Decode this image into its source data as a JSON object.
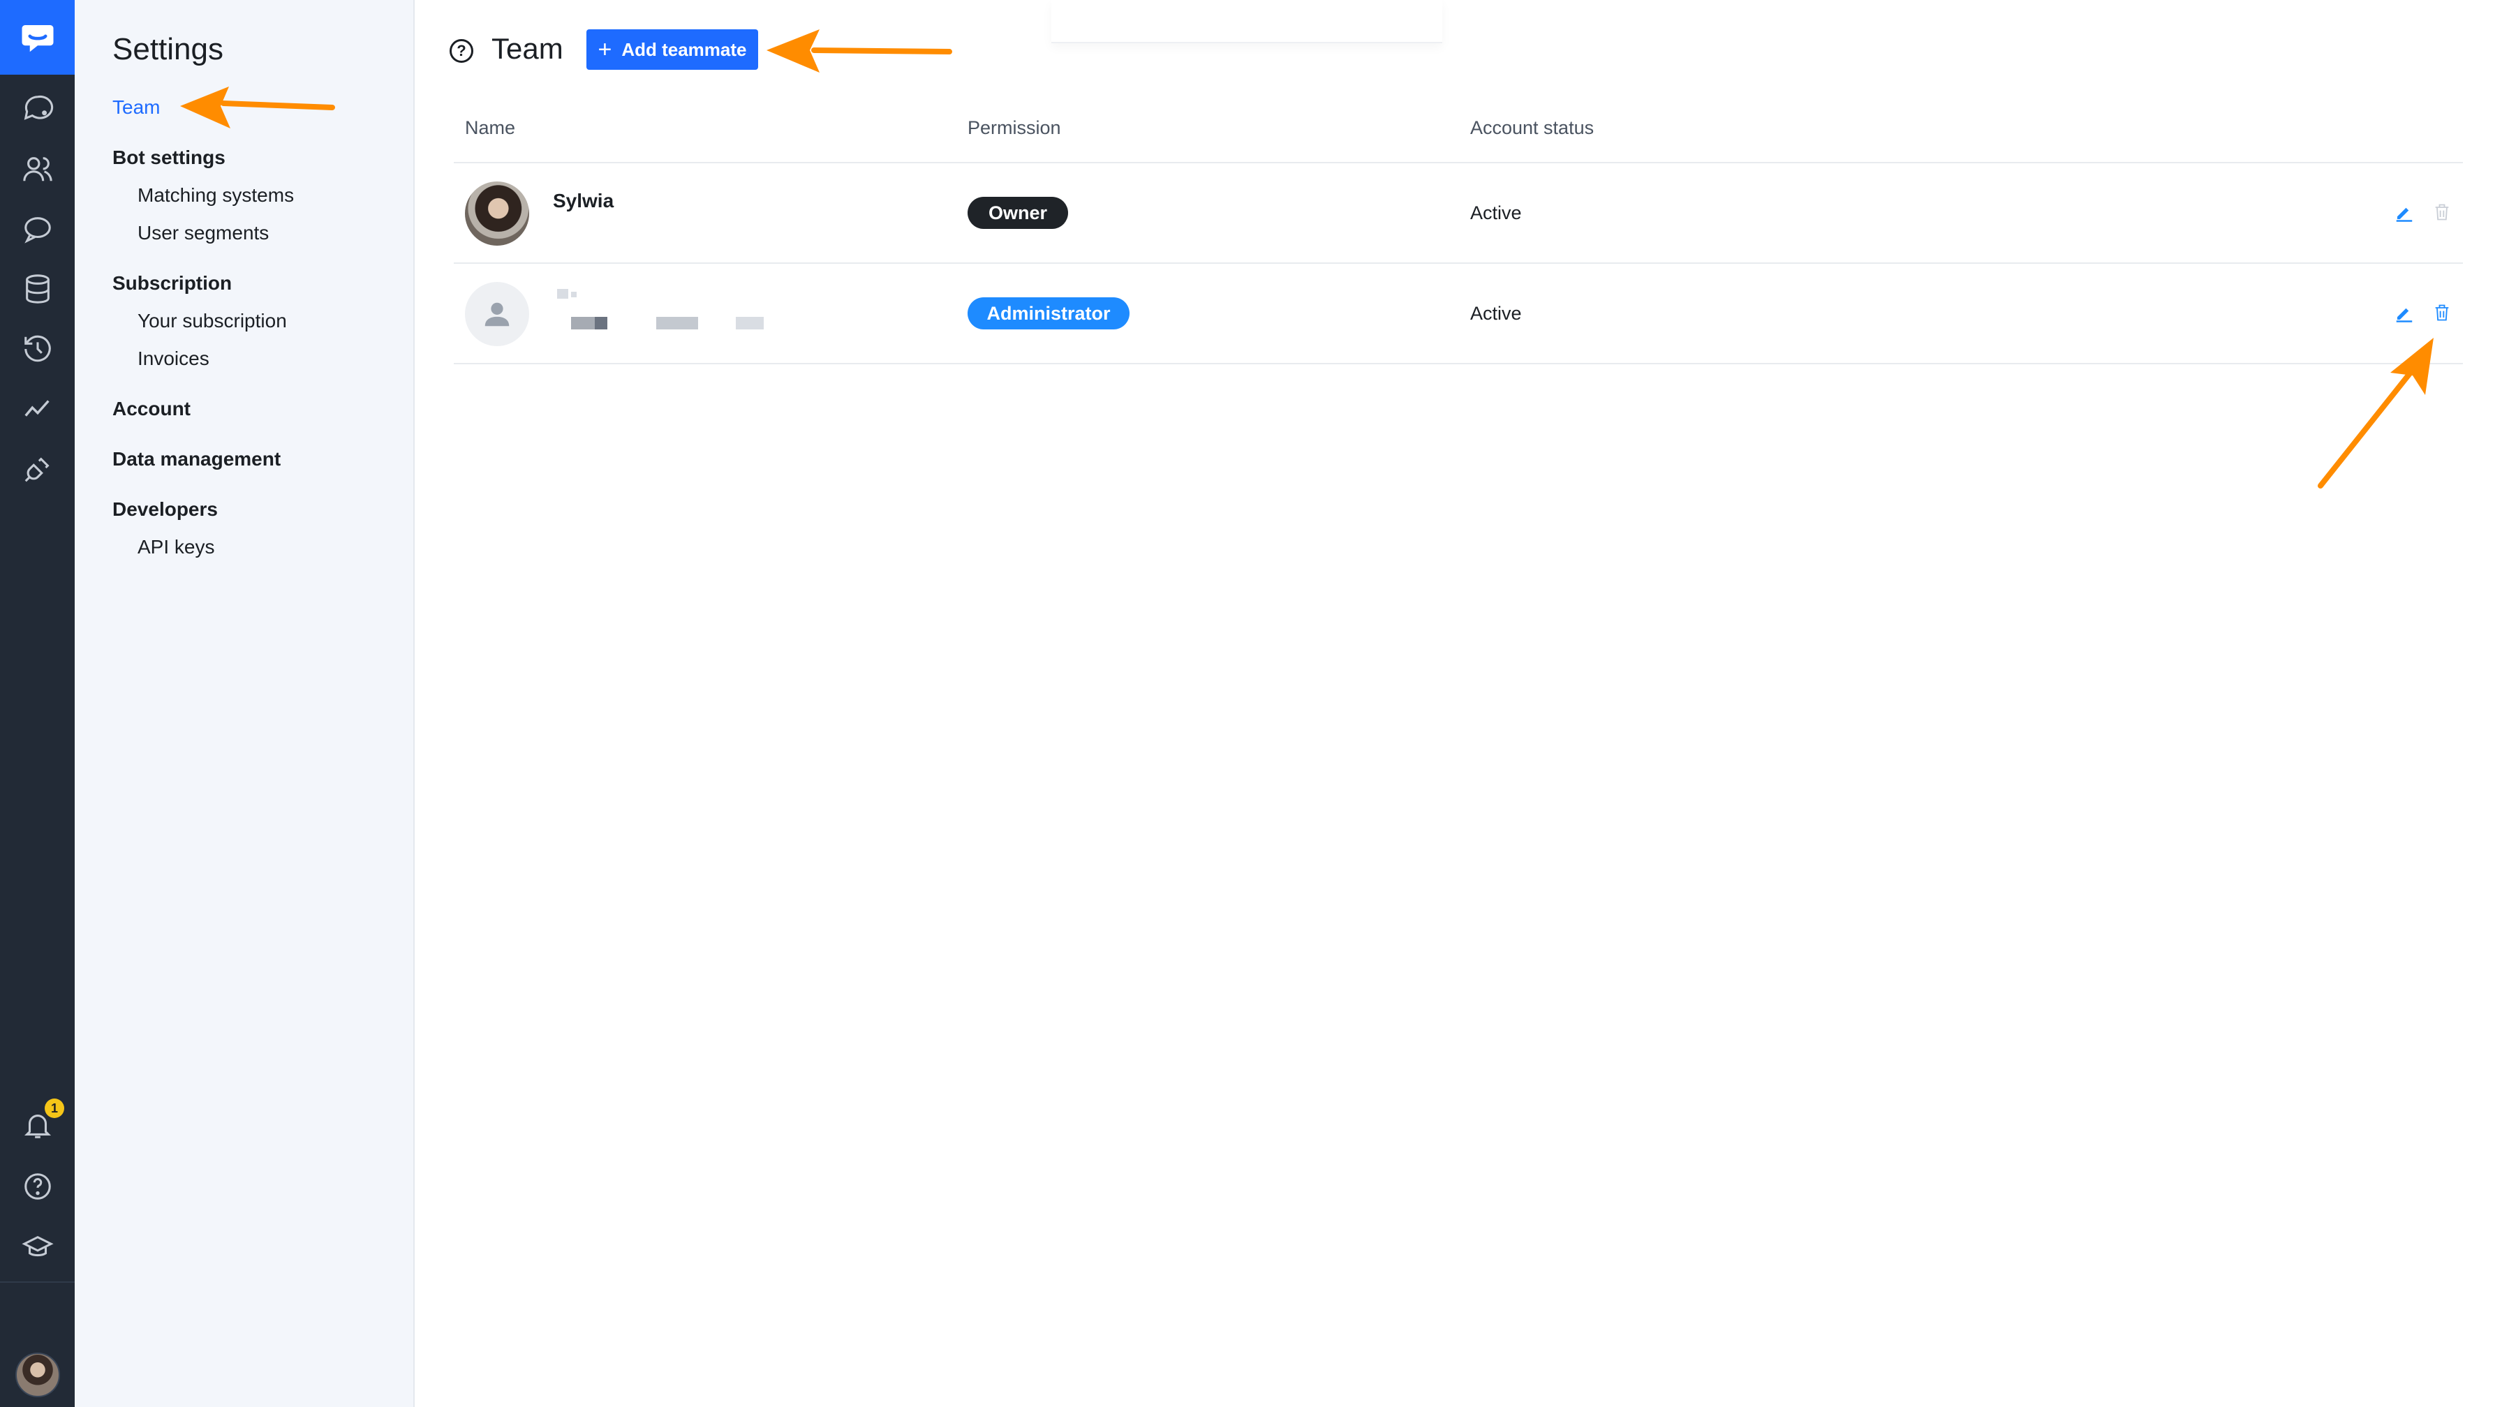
{
  "rail": {
    "items": [
      {
        "name": "conversations-icon"
      },
      {
        "name": "users-icon"
      },
      {
        "name": "chat-icon"
      },
      {
        "name": "database-icon"
      },
      {
        "name": "history-icon"
      },
      {
        "name": "analytics-icon"
      },
      {
        "name": "integrations-icon"
      }
    ],
    "notifications_count": "1"
  },
  "sidebar": {
    "title": "Settings",
    "team": "Team",
    "bot_settings": "Bot settings",
    "matching_systems": "Matching systems",
    "user_segments": "User segments",
    "subscription": "Subscription",
    "your_subscription": "Your subscription",
    "invoices": "Invoices",
    "account": "Account",
    "data_management": "Data management",
    "developers": "Developers",
    "api_keys": "API keys"
  },
  "header": {
    "help": "?",
    "title": "Team",
    "add_button": "Add teammate",
    "add_button_icon": "+"
  },
  "table": {
    "columns": [
      "Name",
      "Permission",
      "Account status"
    ],
    "rows": [
      {
        "name": "Sylwia",
        "permission": "Owner",
        "status": "Active"
      },
      {
        "name": "",
        "permission": "Administrator",
        "status": "Active"
      }
    ]
  },
  "colors": {
    "accent": "#1e6bff",
    "rail": "#222a36",
    "owner_pill": "#1f2328",
    "admin_pill": "#1e8bff",
    "annotation_arrow": "#ff8c00"
  }
}
